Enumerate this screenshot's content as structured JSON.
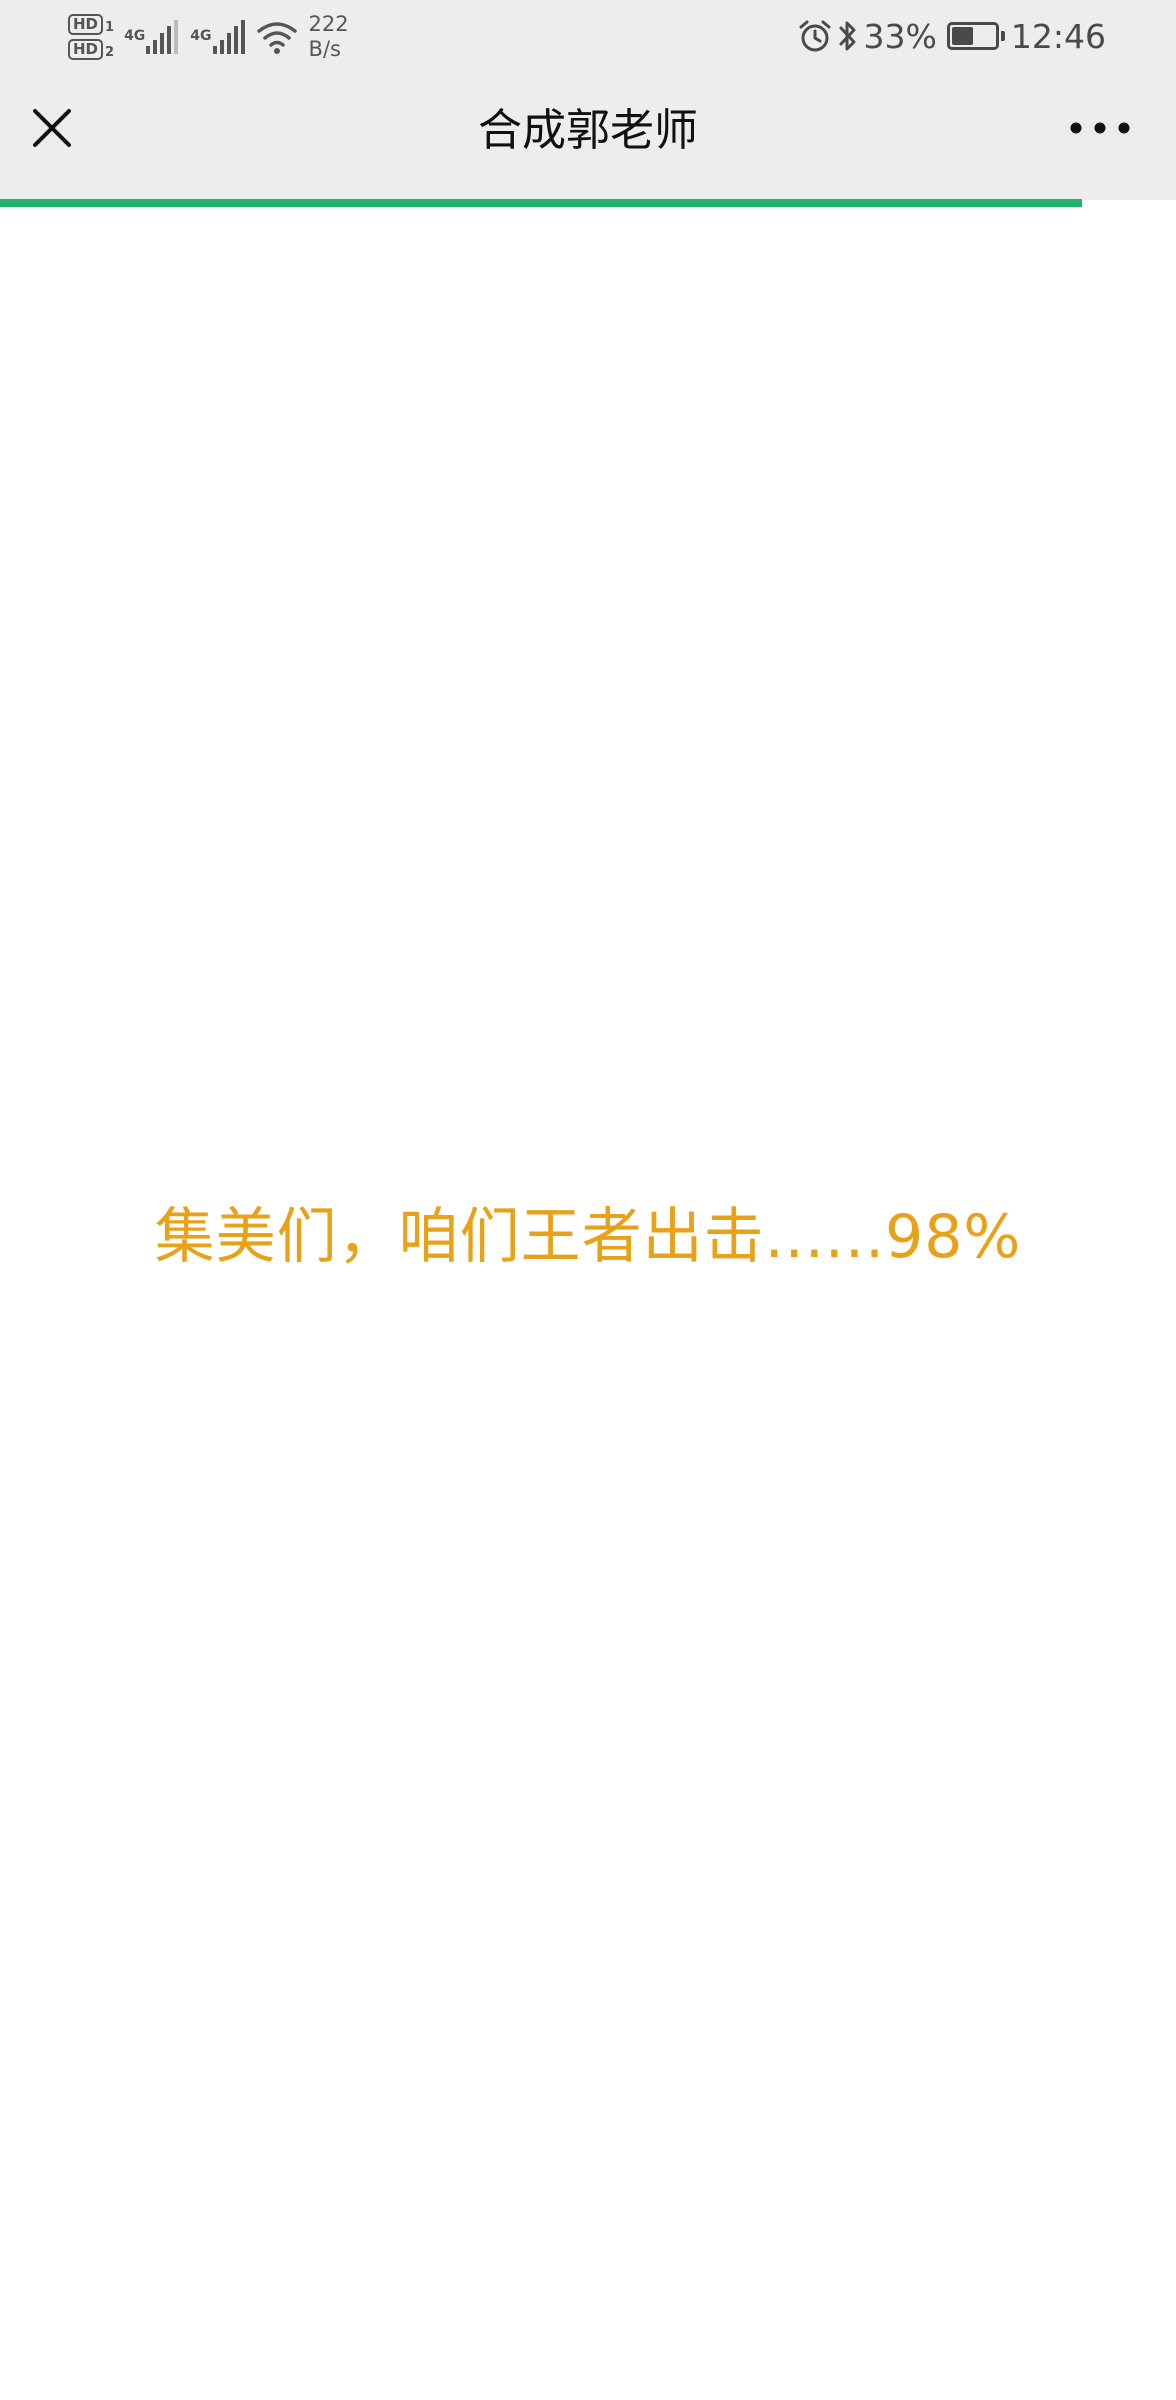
{
  "status_bar": {
    "sim1_label": "HD",
    "sim1_index": "1",
    "sim2_label": "HD",
    "sim2_index": "2",
    "network1": "4G",
    "network2": "4G",
    "net_speed_value": "222",
    "net_speed_unit": "B/s",
    "battery_percent_text": "33%",
    "battery_level": 0.33,
    "time": "12:46",
    "icons": [
      "hd-icon",
      "signal-icon",
      "wifi-icon",
      "alarm-icon",
      "bluetooth-icon",
      "battery-icon"
    ]
  },
  "nav_bar": {
    "title": "合成郭老师",
    "close_icon": "close-icon",
    "more_icon": "more-icon",
    "page_load_progress": 0.92
  },
  "content": {
    "loading_message": "集美们，咱们王者出击......98%"
  },
  "colors": {
    "top_bar_background": "#ededed",
    "progress_green": "#1fb46a",
    "loading_text_orange": "#e8a21a",
    "page_background": "#ffffff"
  }
}
